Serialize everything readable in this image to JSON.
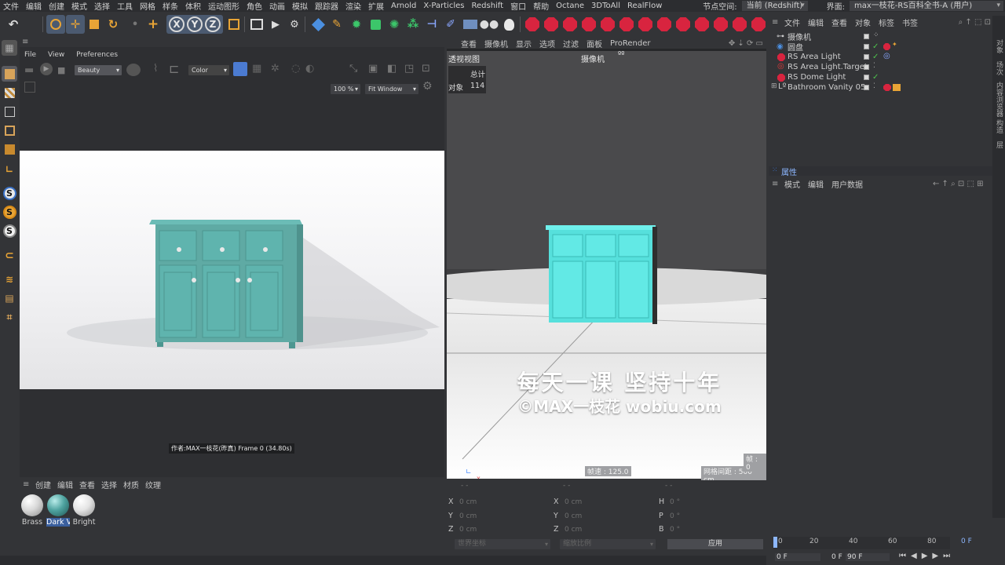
{
  "menubar": {
    "items": [
      "文件",
      "编辑",
      "创建",
      "模式",
      "选择",
      "工具",
      "网格",
      "样条",
      "体积",
      "运动图形",
      "角色",
      "动画",
      "模拟",
      "跟踪器",
      "渲染",
      "扩展",
      "Arnold",
      "X-Particles",
      "Redshift",
      "窗口",
      "帮助",
      "Octane",
      "3DToAll",
      "RealFlow"
    ],
    "node_space_label": "节点空间:",
    "node_space_value": "当前 (Redshift)",
    "layout_label": "界面:",
    "layout_value": "max一枝花-RS百科全书-A (用户)"
  },
  "toolbar": {
    "axis_x": "X",
    "axis_y": "Y",
    "axis_z": "Z"
  },
  "render_view": {
    "menu": [
      "File",
      "View",
      "Preferences"
    ],
    "aov_value": "Beauty",
    "dd2_value": "Color",
    "zoom_value": "100 %",
    "fit_value": "Fit Window",
    "footer_text": "作者:MAX一枝花(昨真)  Frame  0 (34.80s)"
  },
  "viewport": {
    "menu": [
      "查看",
      "摄像机",
      "显示",
      "选项",
      "过滤",
      "面板",
      "ProRender"
    ],
    "view_name": "透视视图",
    "camera_label": "摄像机",
    "hud_total": "总计",
    "hud_objects_label": "对象",
    "hud_objects_value": "114",
    "speed": "帧速 : 125.0",
    "grid_spacing": "网格间距 : 500 cm",
    "frame_badge": "帧 : 0",
    "watermark_line1": "每天一课 坚持十年",
    "watermark_line2": "©MAX一枝花 wobiu.com"
  },
  "object_manager": {
    "menu": [
      "文件",
      "编辑",
      "查看",
      "对象",
      "标签",
      "书签"
    ],
    "objects": [
      {
        "name": "摄像机",
        "tick": ""
      },
      {
        "name": "圆盘",
        "tick": "✓"
      },
      {
        "name": "RS Area Light",
        "tick": "✓"
      },
      {
        "name": "RS Area Light.Target",
        "tick": ""
      },
      {
        "name": "RS Dome Light",
        "tick": "✓"
      },
      {
        "name": "Bathroom Vanity 05",
        "tick": ""
      }
    ]
  },
  "attributes": {
    "title": "属性",
    "menu": [
      "模式",
      "编辑",
      "用户数据"
    ]
  },
  "materials": {
    "menu": [
      "创建",
      "编辑",
      "查看",
      "选择",
      "材质",
      "纹理"
    ],
    "items": [
      {
        "name": "Brass",
        "color": "#e6e6e6"
      },
      {
        "name": "Dark V",
        "color": "#4fa3a0"
      },
      {
        "name": "Bright",
        "color": "#f0f0f0"
      }
    ]
  },
  "coordinates": {
    "pos_x": "0 cm",
    "pos_y": "0 cm",
    "pos_z": "0 cm",
    "size_x": "0 cm",
    "size_y": "0 cm",
    "size_z": "0 cm",
    "rot_h": "0 °",
    "rot_p": "0 °",
    "rot_b": "0 °",
    "mode_value": "世界坐标",
    "scale_value": "缩放比例",
    "apply_label": "应用"
  },
  "timeline": {
    "ticks": [
      "0",
      "20",
      "40",
      "60",
      "80"
    ],
    "current_frame": "0 F",
    "start_frame": "0 F",
    "min_frame": "0 F",
    "end_frame": "90 F"
  },
  "side_tabs": [
    "对象",
    "场次",
    "内容浏览器",
    "构造",
    "层"
  ],
  "colors": {
    "accent": "#4b7bd1",
    "redshift_red": "#d8243f",
    "cabinet": "#5fb4ae",
    "cabinet_viewport": "#56e0dc"
  }
}
